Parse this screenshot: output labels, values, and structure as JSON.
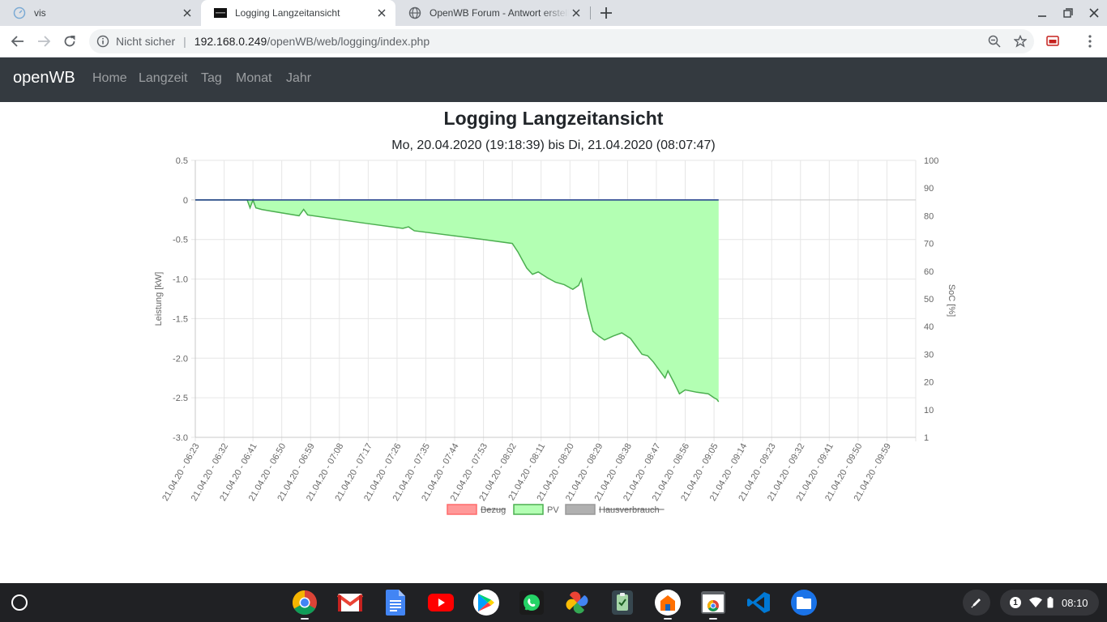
{
  "browser": {
    "tabs": [
      {
        "title": "vis",
        "active": false
      },
      {
        "title": "Logging Langzeitansicht",
        "active": true
      },
      {
        "title": "OpenWB Forum - Antwort erstellen",
        "active": false
      }
    ],
    "address": {
      "security_label": "Nicht sicher",
      "host": "192.168.0.249",
      "path": "/openWB/web/logging/index.php"
    }
  },
  "navbar": {
    "brand": "openWB",
    "links": [
      "Home",
      "Langzeit",
      "Tag",
      "Monat",
      "Jahr"
    ]
  },
  "page": {
    "title": "Logging Langzeitansicht",
    "range": "Mo, 20.04.2020 (19:18:39) bis Di, 21.04.2020 (08:07:47)"
  },
  "colors": {
    "navbar_bg": "#343a40",
    "pv_fill": "#b3ffb3",
    "pv_line": "#4caf50",
    "bezug": "#ff9999",
    "hausverbrauch": "#b0b0b0",
    "zero_line": "#1e3a8a"
  },
  "chart_data": {
    "type": "area",
    "x": [
      "21.04.20 - 06:23",
      "21.04.20 - 06:32",
      "21.04.20 - 06:41",
      "21.04.20 - 06:50",
      "21.04.20 - 06:59",
      "21.04.20 - 07:08",
      "21.04.20 - 07:17",
      "21.04.20 - 07:26",
      "21.04.20 - 07:35",
      "21.04.20 - 07:44",
      "21.04.20 - 07:53",
      "21.04.20 - 08:02",
      "21.04.20 - 08:11",
      "21.04.20 - 08:20",
      "21.04.20 - 08:29",
      "21.04.20 - 08:38",
      "21.04.20 - 08:47",
      "21.04.20 - 08:56",
      "21.04.20 - 09:05",
      "21.04.20 - 09:14",
      "21.04.20 - 09:23",
      "21.04.20 - 09:32",
      "21.04.20 - 09:41",
      "21.04.20 - 09:50",
      "21.04.20 - 09:59"
    ],
    "ylabel": "Leistung [kW]",
    "ylim": [
      -3.0,
      0.5
    ],
    "yticks": [
      "0.5",
      "0",
      "-0.5",
      "-1.0",
      "-1.5",
      "-2.0",
      "-2.5",
      "-3.0"
    ],
    "y2label": "SoC [%]",
    "y2ticks": [
      "100",
      "90",
      "80",
      "70",
      "60",
      "50",
      "40",
      "30",
      "20",
      "10",
      "1"
    ],
    "grid": true,
    "legend_position": "bottom",
    "series": [
      {
        "name": "Bezug",
        "hidden": true,
        "values": []
      },
      {
        "name": "PV",
        "hidden": false,
        "values": [
          [
            0,
            0
          ],
          [
            9,
            0
          ],
          [
            9.5,
            -0.1
          ],
          [
            10,
            0
          ],
          [
            10.5,
            -0.1
          ],
          [
            11.5,
            -0.12
          ],
          [
            13,
            -0.14
          ],
          [
            18,
            -0.2
          ],
          [
            18.8,
            -0.12
          ],
          [
            19.5,
            -0.19
          ],
          [
            29,
            -0.29
          ],
          [
            36,
            -0.36
          ],
          [
            37,
            -0.34
          ],
          [
            38,
            -0.39
          ],
          [
            50,
            -0.5
          ],
          [
            55,
            -0.55
          ],
          [
            56,
            -0.66
          ],
          [
            57.5,
            -0.86
          ],
          [
            58.5,
            -0.94
          ],
          [
            59.5,
            -0.91
          ],
          [
            61,
            -0.98
          ],
          [
            62.5,
            -1.04
          ],
          [
            64,
            -1.07
          ],
          [
            65.5,
            -1.13
          ],
          [
            66.5,
            -1.08
          ],
          [
            67,
            -1.0
          ],
          [
            68,
            -1.38
          ],
          [
            69,
            -1.66
          ],
          [
            70,
            -1.72
          ],
          [
            71,
            -1.77
          ],
          [
            72.5,
            -1.72
          ],
          [
            74,
            -1.68
          ],
          [
            75.5,
            -1.75
          ],
          [
            76.5,
            -1.85
          ],
          [
            77.5,
            -1.95
          ],
          [
            78.5,
            -1.97
          ],
          [
            79.5,
            -2.05
          ],
          [
            80.5,
            -2.15
          ],
          [
            81.5,
            -2.25
          ],
          [
            82,
            -2.16
          ],
          [
            83,
            -2.3
          ],
          [
            84,
            -2.45
          ],
          [
            85,
            -2.4
          ],
          [
            87,
            -2.43
          ],
          [
            89,
            -2.45
          ],
          [
            90,
            -2.5
          ],
          [
            90.5,
            -2.52
          ],
          [
            90.8,
            -2.55
          ]
        ]
      },
      {
        "name": "Hausverbrauch",
        "hidden": true,
        "values": []
      }
    ]
  },
  "shelf": {
    "notification_count": "1",
    "time": "08:10"
  }
}
